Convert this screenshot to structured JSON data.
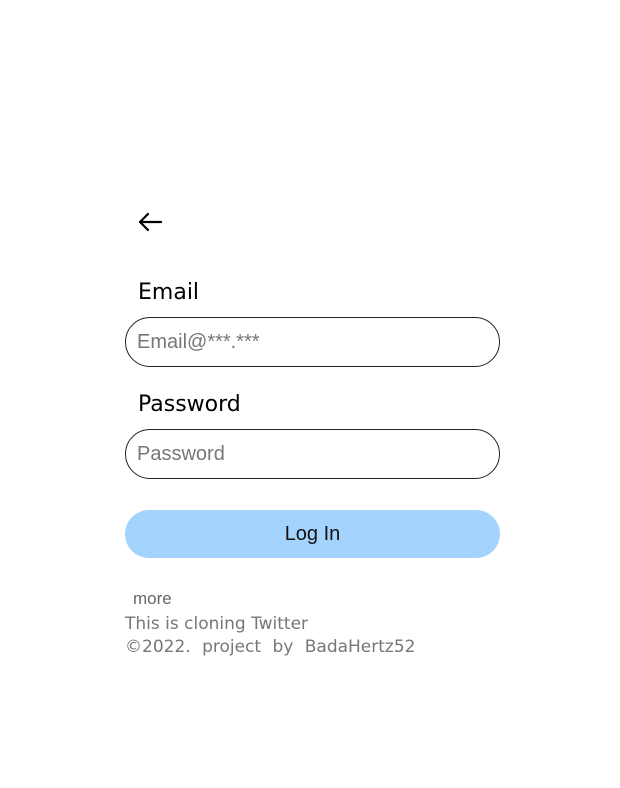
{
  "nav": {
    "back_icon": "arrow-left-icon"
  },
  "form": {
    "email_label": "Email",
    "email_placeholder": "Email@***.***",
    "email_value": "",
    "password_label": "Password",
    "password_placeholder": "Password",
    "password_value": "",
    "login_label": "Log In"
  },
  "footer": {
    "more_label": "more",
    "line1": "This is cloning Twitter",
    "line2": "©2022. project by BadaHertz52"
  },
  "colors": {
    "login_button_bg": "#a4d3fe",
    "muted_text": "#777777",
    "input_border": "#222222"
  }
}
